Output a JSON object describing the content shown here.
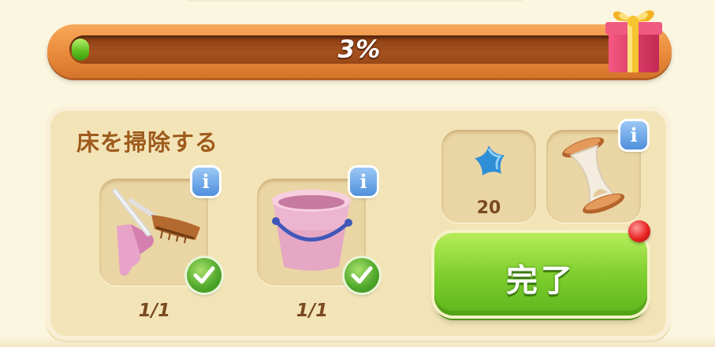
{
  "progress": {
    "percent": 3,
    "label": "3%"
  },
  "task": {
    "title": "床を掃除する",
    "items": [
      {
        "name": "dustpan-and-brush",
        "icon": "dustpan-brush-icon",
        "count": "1/1",
        "completed": true
      },
      {
        "name": "bucket",
        "icon": "bucket-icon",
        "count": "1/1",
        "completed": true
      }
    ],
    "rewards": [
      {
        "icon": "blue-star-icon",
        "count": "20"
      },
      {
        "icon": "hourglass-icon"
      }
    ],
    "complete_label": "完了",
    "info_label": "i"
  },
  "colors": {
    "accent_green": "#7fcf2f",
    "progress_orange": "#e98a3b",
    "title_brown": "#9e5b1c",
    "info_blue": "#4f8fdc"
  }
}
